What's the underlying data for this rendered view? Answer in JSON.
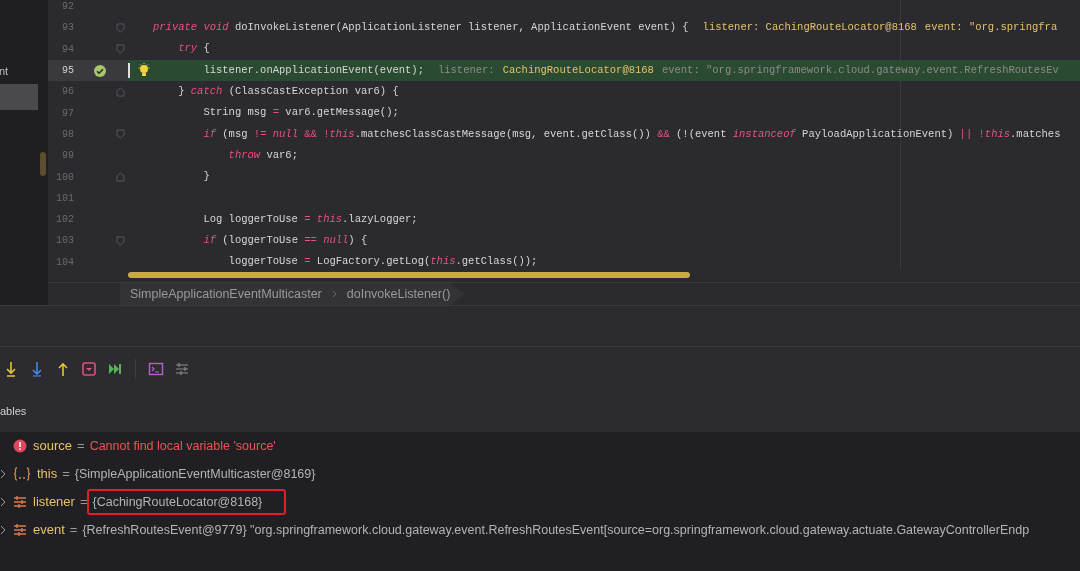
{
  "sidebar": {
    "items": [
      {
        "label": "nt",
        "selected": false
      },
      {
        "selected": true
      }
    ]
  },
  "editor": {
    "lines": [
      {
        "number": "92"
      },
      {
        "number": "93",
        "fold_start": true,
        "segments": [
          {
            "kind": "keyword",
            "text": "private void"
          },
          {
            "kind": "plain",
            "text": " doInvokeListener(ApplicationListener listener, ApplicationEvent event) {"
          }
        ],
        "hints": [
          {
            "kind": "value",
            "text": "listener: CachingRouteLocator@8168"
          },
          {
            "kind": "value",
            "text": "event: \"org.springfra"
          }
        ]
      },
      {
        "number": "94",
        "fold_start": true,
        "segments": [
          {
            "kind": "keyword",
            "text": "    try"
          },
          {
            "kind": "plain",
            "text": " {"
          }
        ]
      },
      {
        "number": "95",
        "current": true,
        "breakpoint": true,
        "segments": [
          {
            "kind": "plain",
            "text": "        listener.onApplicationEvent(event);"
          }
        ],
        "hints": [
          {
            "kind": "label",
            "text": "listener:"
          },
          {
            "kind": "value",
            "text": "CachingRouteLocator@8168"
          },
          {
            "kind": "label",
            "text": "event: \"org.springframework.cloud.gateway.event.RefreshRoutesEv"
          }
        ]
      },
      {
        "number": "96",
        "fold_end": true,
        "segments": [
          {
            "kind": "plain",
            "text": "    } "
          },
          {
            "kind": "keyword",
            "text": "catch"
          },
          {
            "kind": "plain",
            "text": " (ClassCastException var6) {"
          }
        ]
      },
      {
        "number": "97",
        "segments": [
          {
            "kind": "plain",
            "text": "        String msg "
          },
          {
            "kind": "operator",
            "text": "="
          },
          {
            "kind": "plain",
            "text": " var6.getMessage();"
          }
        ]
      },
      {
        "number": "98",
        "fold_start": true,
        "segments": [
          {
            "kind": "keyword",
            "text": "        if"
          },
          {
            "kind": "plain",
            "text": " (msg "
          },
          {
            "kind": "operator",
            "text": "!= "
          },
          {
            "kind": "keyword",
            "text": "null"
          },
          {
            "kind": "operator",
            "text": " && !"
          },
          {
            "kind": "keyword",
            "text": "this"
          },
          {
            "kind": "plain",
            "text": ".matchesClassCastMessage(msg, event.getClass()) "
          },
          {
            "kind": "operator",
            "text": "&&"
          },
          {
            "kind": "plain",
            "text": " (!(event "
          },
          {
            "kind": "keyword",
            "text": "instanceof"
          },
          {
            "kind": "plain",
            "text": " PayloadApplicationEvent) "
          },
          {
            "kind": "operator",
            "text": "|| !"
          },
          {
            "kind": "keyword",
            "text": "this"
          },
          {
            "kind": "plain",
            "text": ".matches"
          }
        ]
      },
      {
        "number": "99",
        "segments": [
          {
            "kind": "keyword",
            "text": "            throw"
          },
          {
            "kind": "plain",
            "text": " var6;"
          }
        ]
      },
      {
        "number": "100",
        "fold_end": true,
        "segments": [
          {
            "kind": "plain",
            "text": "        }"
          }
        ]
      },
      {
        "number": "101"
      },
      {
        "number": "102",
        "segments": [
          {
            "kind": "plain",
            "text": "        Log loggerToUse "
          },
          {
            "kind": "operator",
            "text": "= "
          },
          {
            "kind": "keyword",
            "text": "this"
          },
          {
            "kind": "plain",
            "text": ".lazyLogger;"
          }
        ]
      },
      {
        "number": "103",
        "fold_start": true,
        "segments": [
          {
            "kind": "keyword",
            "text": "        if"
          },
          {
            "kind": "plain",
            "text": " (loggerToUse "
          },
          {
            "kind": "operator",
            "text": "== "
          },
          {
            "kind": "keyword",
            "text": "null"
          },
          {
            "kind": "plain",
            "text": ") {"
          }
        ]
      },
      {
        "number": "104",
        "segments": [
          {
            "kind": "plain",
            "text": "            loggerToUse "
          },
          {
            "kind": "operator",
            "text": "="
          },
          {
            "kind": "plain",
            "text": " LogFactory.getLog("
          },
          {
            "kind": "keyword",
            "text": "this"
          },
          {
            "kind": "plain",
            "text": ".getClass());"
          }
        ]
      }
    ]
  },
  "breadcrumbs": [
    "SimpleApplicationEventMulticaster",
    "doInvokeListener()"
  ],
  "debug_toolbar": [
    {
      "kind": "step-over"
    },
    {
      "kind": "step-into"
    },
    {
      "kind": "step-out"
    },
    {
      "kind": "drop-frame"
    },
    {
      "kind": "run-to-cursor"
    },
    {
      "kind": "separator"
    },
    {
      "kind": "console"
    },
    {
      "kind": "trace"
    }
  ],
  "variables": {
    "title": "ables",
    "rows": [
      {
        "kind": "error",
        "name": "source",
        "operator": "=",
        "value": "Cannot find local variable 'source'"
      },
      {
        "kind": "object",
        "name": "this",
        "operator": "=",
        "value": "{SimpleApplicationEventMulticaster@8169}"
      },
      {
        "kind": "field",
        "name": "listener",
        "operator": "=",
        "value": "{CachingRouteLocator@8168}",
        "highlighted": true
      },
      {
        "kind": "field",
        "name": "event",
        "operator": "=",
        "value": "{RefreshRoutesEvent@9779} \"org.springframework.cloud.gateway.event.RefreshRoutesEvent[source=org.springframework.cloud.gateway.actuate.GatewayControllerEndp"
      }
    ]
  }
}
